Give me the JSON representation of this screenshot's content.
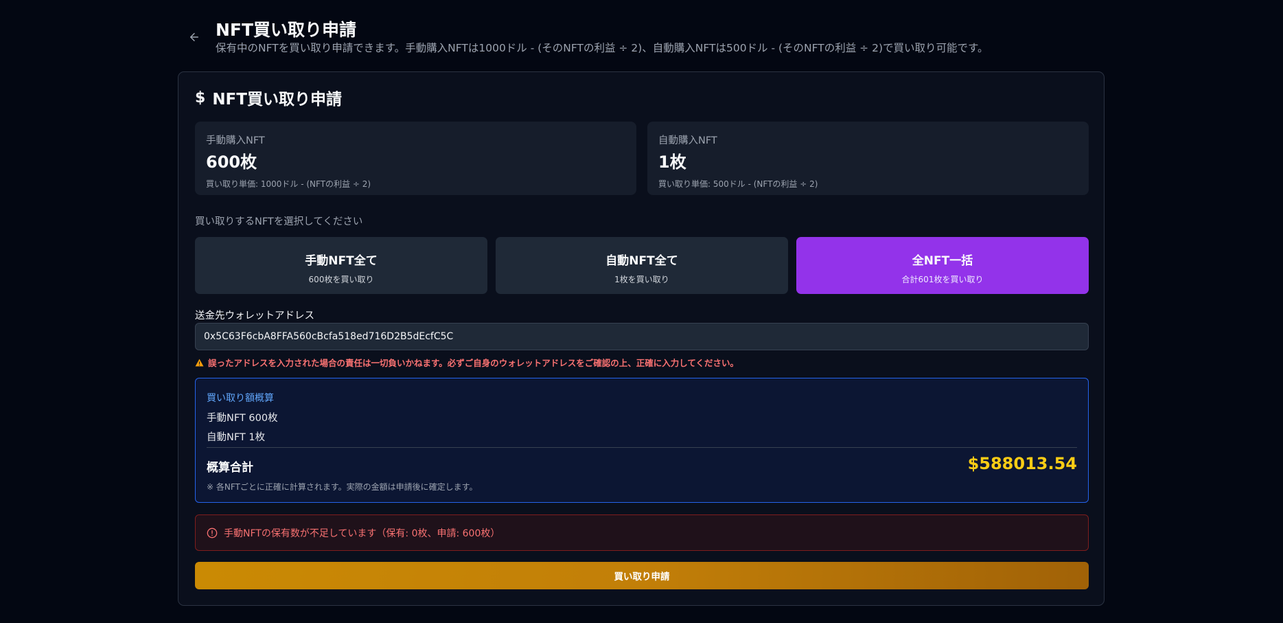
{
  "header": {
    "title": "NFT買い取り申請",
    "description": "保有中のNFTを買い取り申請できます。手動購入NFTは1000ドル - (そのNFTの利益 ÷ 2)、自動購入NFTは500ドル - (そのNFTの利益 ÷ 2)で買い取り可能です。",
    "back_icon": "arrow-left-icon"
  },
  "card": {
    "title": "NFT買い取り申請",
    "title_icon": "$",
    "stats": [
      {
        "label": "手動購入NFT",
        "value": "600枚",
        "note": "買い取り単価: 1000ドル - (NFTの利益 ÷ 2)"
      },
      {
        "label": "自動購入NFT",
        "value": "1枚",
        "note": "買い取り単価: 500ドル - (NFTの利益 ÷ 2)"
      }
    ],
    "select_label": "買い取りするNFTを選択してください",
    "options": [
      {
        "title": "手動NFT全て",
        "sub": "600枚を買い取り",
        "selected": false
      },
      {
        "title": "自動NFT全て",
        "sub": "1枚を買い取り",
        "selected": false
      },
      {
        "title": "全NFT一括",
        "sub": "合計601枚を買い取り",
        "selected": true
      }
    ],
    "wallet_label": "送金先ウォレットアドレス",
    "wallet_value": "0x5C63F6cbA8FFA560cBcfa518ed716D2B5dEcfC5C",
    "warning_text": "誤ったアドレスを入力された場合の責任は一切負いかねます。必ずご自身のウォレットアドレスをご確認の上、正確に入力してください。",
    "estimate": {
      "title": "買い取り額概算",
      "line1": "手動NFT 600枚",
      "line2": "自動NFT 1枚",
      "total_label": "概算合計",
      "total_value": "$588013.54",
      "note": "※ 各NFTごとに正確に計算されます。実際の金額は申請後に確定します。"
    },
    "error_text": "手動NFTの保有数が不足しています（保有: 0枚、申請: 600枚）",
    "submit_label": "買い取り申請"
  },
  "colors": {
    "background": "#030712",
    "accent_selected": "#9333ea",
    "total_value": "#facc15",
    "error": "#f87171",
    "estimate_border": "#2563eb",
    "submit_gradient": "#ca8a04"
  }
}
